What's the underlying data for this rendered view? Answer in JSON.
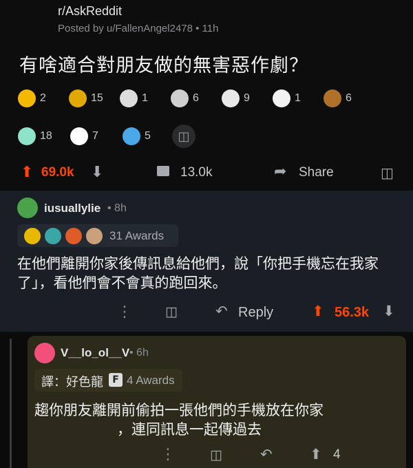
{
  "post": {
    "subreddit": "r/AskReddit",
    "meta": "Posted by u/FallenAngel2478 • 11h",
    "title": "有啥適合對朋友做的無害惡作劇？",
    "awards_row1": [
      {
        "icon": "star-award-icon",
        "count": "2",
        "color": "#f5b800"
      },
      {
        "icon": "gold-trophy-icon",
        "count": "15",
        "color": "#e0a800"
      },
      {
        "icon": "f-key-award-icon",
        "count": "1",
        "color": "#dddddd"
      },
      {
        "icon": "clapping-hands-icon",
        "count": "6",
        "color": "#cfcfcf"
      },
      {
        "icon": "laughing-face-icon",
        "count": "9",
        "color": "#e8e8e8"
      },
      {
        "icon": "crying-laughing-icon",
        "count": "1",
        "color": "#f2f2f2"
      },
      {
        "icon": "monkey-icon",
        "count": "6",
        "color": "#b0702a"
      }
    ],
    "awards_row2": [
      {
        "icon": "angel-icon",
        "count": "18",
        "color": "#8fe3c9"
      },
      {
        "icon": "snoo-icon",
        "count": "7",
        "color": "#ffffff"
      },
      {
        "icon": "heart-snoo-icon",
        "count": "5",
        "color": "#4aa7e8"
      }
    ],
    "upvotes": "69.0k",
    "comments": "13.0k",
    "share_label": "Share"
  },
  "comment1": {
    "user": "iusuallylie",
    "time": "• 8h",
    "awards_label": "31 Awards",
    "body": "在他們離開你家後傳訊息給他們，說「你把手機忘在我家了」，看他們會不會真的跑回來。",
    "reply_label": "Reply",
    "upvotes": "56.3k"
  },
  "comment2": {
    "user": "V__lo_ol__V",
    "time": "• 6h",
    "watermark": "譯：好色龍",
    "awards_label": "4 Awards",
    "body_line1": "趨你朋友離開前偷拍一張他們的手機放在你家",
    "body_line2": "，連同訊息一起傳過去",
    "upvotes": "4"
  }
}
